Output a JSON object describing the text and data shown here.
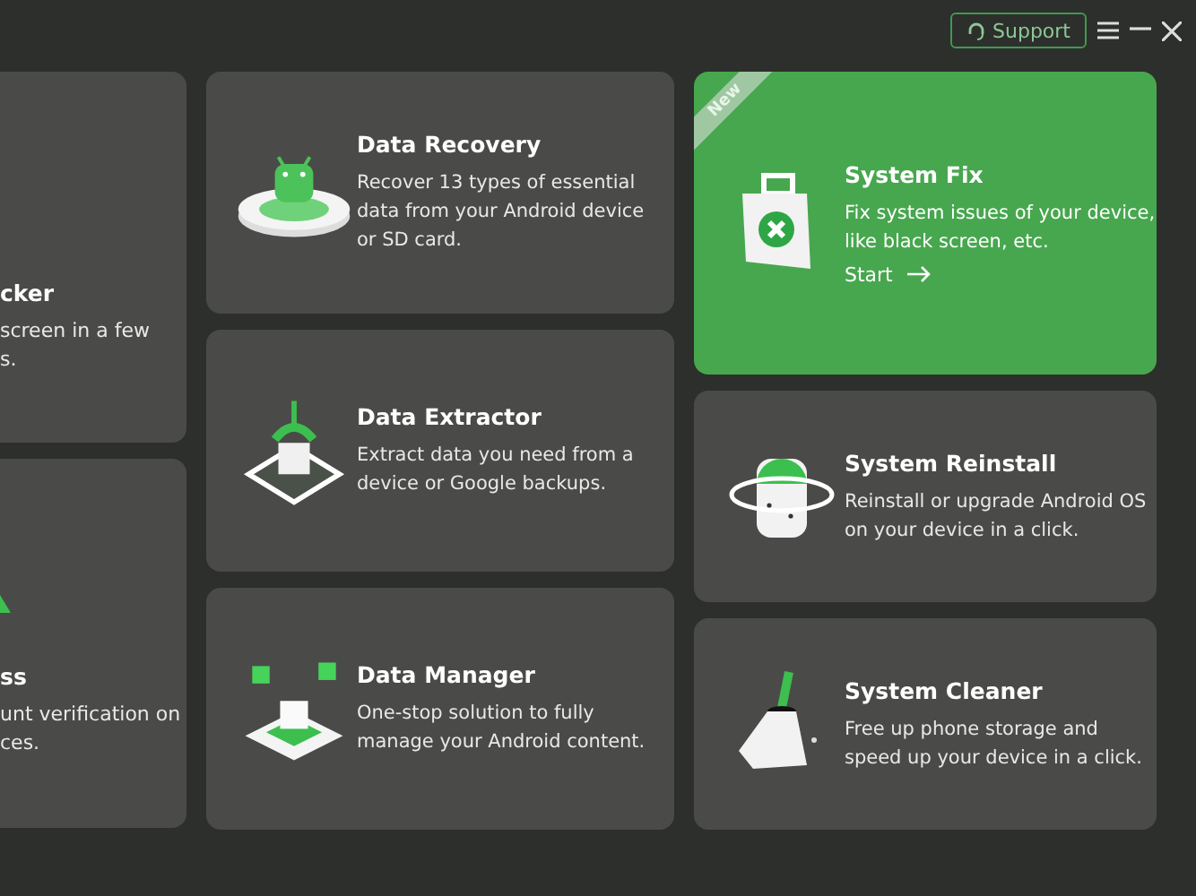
{
  "header": {
    "support_button": "Support"
  },
  "left_column": [
    {
      "title": "cker",
      "description_lines": [
        "screen in a few",
        "s."
      ]
    },
    {
      "title": "ss",
      "description_lines": [
        "unt verification on",
        "ces."
      ]
    }
  ],
  "middle_column": [
    {
      "title": "Data Recovery",
      "description": "Recover 13 types of essential data from your Android device or SD card."
    },
    {
      "title": "Data Extractor",
      "description": "Extract data you need from a device or Google backups."
    },
    {
      "title": "Data Manager",
      "description": "One-stop solution to fully manage your Android content."
    }
  ],
  "right_column": [
    {
      "title": "System Fix",
      "description": "Fix system issues of your device, like black screen, etc.",
      "featured": true,
      "badge": "New",
      "action": "Start"
    },
    {
      "title": "System Reinstall",
      "description": "Reinstall or upgrade Android OS on your device in a click.",
      "featured": false
    },
    {
      "title": "System Cleaner",
      "description": "Free up phone storage and speed up your device in a click.",
      "featured": false
    }
  ]
}
